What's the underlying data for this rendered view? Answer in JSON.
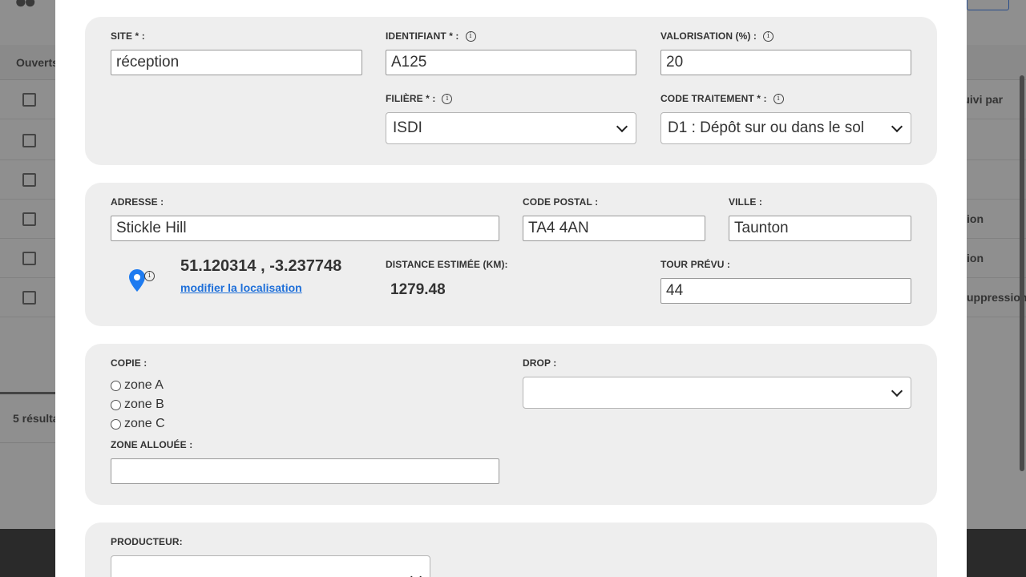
{
  "background": {
    "tab_label": "Ouverts",
    "right_column_header": "Suivi par",
    "row_right_texts": [
      "",
      "",
      "ion",
      "ion",
      "uppression"
    ],
    "results_text": "5 résulta"
  },
  "site": {
    "label": "SITE * :",
    "value": "réception"
  },
  "identifiant": {
    "label": "IDENTIFIANT * :",
    "value": "A125"
  },
  "valorisation": {
    "label": "VALORISATION (%) :",
    "value": "20"
  },
  "filiere": {
    "label": "FILIÈRE * :",
    "value": "ISDI"
  },
  "code_traitement": {
    "label": "CODE TRAITEMENT * :",
    "value": "D1 : Dépôt sur ou dans le sol"
  },
  "adresse": {
    "label": "ADRESSE :",
    "value": "Stickle Hill"
  },
  "code_postal": {
    "label": "CODE POSTAL :",
    "value": "TA4 4AN"
  },
  "ville": {
    "label": "VILLE :",
    "value": "Taunton"
  },
  "location": {
    "coords": "51.120314 , -3.237748",
    "modify_link": "modifier la localisation",
    "pin_color": "#1e7bf0"
  },
  "distance": {
    "label": "DISTANCE ESTIMÉE (KM):",
    "value": "1279.48"
  },
  "tour": {
    "label": "TOUR PRÉVU :",
    "value": "44"
  },
  "copie": {
    "label": "COPIE :",
    "options": [
      "zone A",
      "zone B",
      "zone C"
    ]
  },
  "drop": {
    "label": "DROP :",
    "value": ""
  },
  "zone_allouee": {
    "label": "ZONE ALLOUÉE :",
    "value": ""
  },
  "producteur": {
    "label": "PRODUCTEUR:",
    "value": ""
  },
  "info_glyph": "i"
}
